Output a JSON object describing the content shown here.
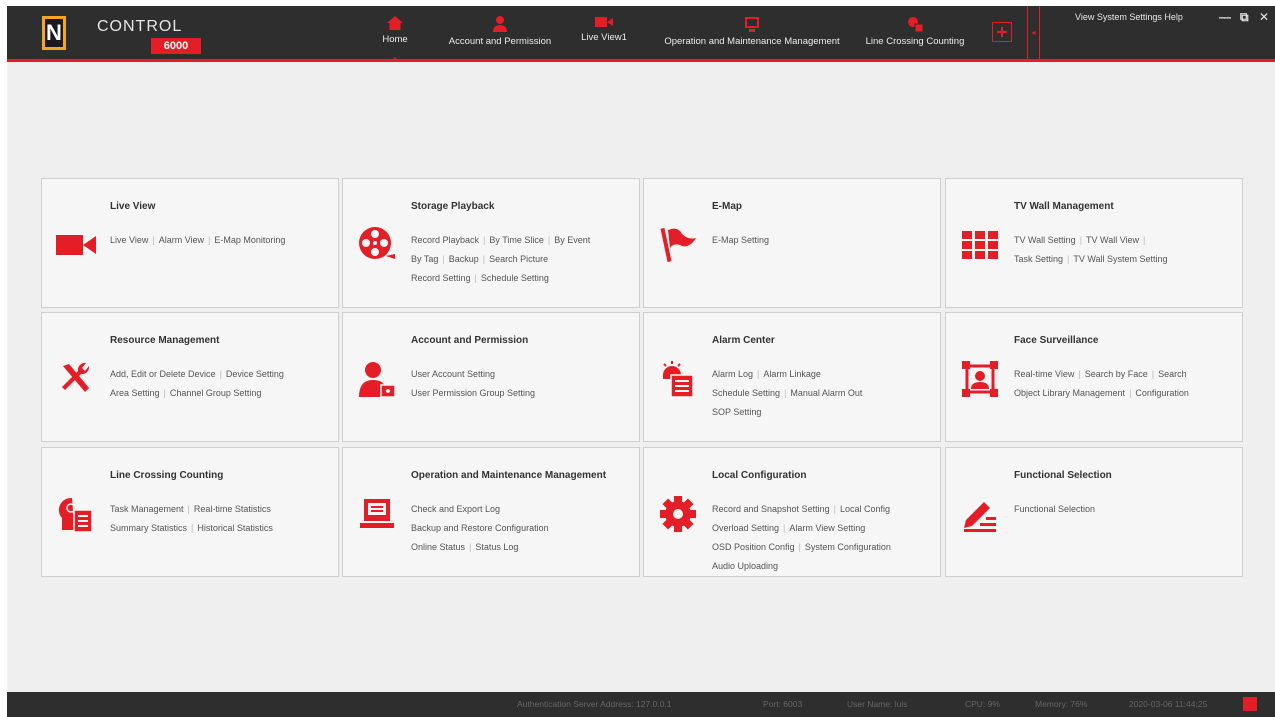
{
  "app": {
    "logo_letter": "N",
    "logo_text": "CONTROL",
    "logo_badge": "6000"
  },
  "nav": [
    {
      "label": "Home",
      "icon": "home-icon"
    },
    {
      "label": "Account and Permission",
      "icon": "user-icon"
    },
    {
      "label": "Live View1",
      "icon": "camera-icon"
    },
    {
      "label": "Operation and Maintenance Management",
      "icon": "monitor-icon"
    },
    {
      "label": "Line Crossing Counting",
      "icon": "counting-icon"
    }
  ],
  "top_menu": "View  System  Settings  Help",
  "cards": [
    {
      "title": "Live View",
      "icon": "video-camera-icon",
      "links": [
        "Live View",
        "Alarm View",
        "E-Map Monitoring"
      ]
    },
    {
      "title": "Storage Playback",
      "icon": "film-reel-icon",
      "links": [
        "Record Playback",
        "By Time Slice",
        "By Event",
        "By Tag",
        "Backup",
        "Search Picture",
        "Record Setting",
        "Schedule Setting"
      ]
    },
    {
      "title": "E-Map",
      "icon": "flag-icon",
      "links": [
        "E-Map Setting"
      ]
    },
    {
      "title": "TV Wall Management",
      "icon": "tv-wall-icon",
      "links": [
        "TV Wall Setting",
        "TV Wall View",
        "Task Setting",
        "TV Wall System Setting"
      ]
    },
    {
      "title": "Resource Management",
      "icon": "tools-icon",
      "links": [
        "Add, Edit or Delete Device",
        "Device Setting",
        "Area Setting",
        "Channel Group Setting"
      ]
    },
    {
      "title": "Account and Permission",
      "icon": "user-lock-icon",
      "links": [
        "User Account Setting",
        "User Permission Group Setting"
      ]
    },
    {
      "title": "Alarm Center",
      "icon": "alarm-list-icon",
      "links": [
        "Alarm Log",
        "Alarm Linkage",
        "Schedule Setting",
        "Manual Alarm Out",
        "SOP Setting"
      ]
    },
    {
      "title": "Face Surveillance",
      "icon": "face-scan-icon",
      "links": [
        "Real-time View",
        "Search by Face",
        "Search",
        "Object Library Management",
        "Configuration"
      ]
    },
    {
      "title": "Line Crossing Counting",
      "icon": "head-report-icon",
      "links": [
        "Task Management",
        "Real-time Statistics",
        "Summary Statistics",
        "Historical Statistics"
      ]
    },
    {
      "title": "Operation and Maintenance Management",
      "icon": "laptop-icon",
      "links": [
        "Check and Export Log",
        "Backup and Restore Configuration",
        "Online Status",
        "Status Log"
      ]
    },
    {
      "title": "Local Configuration",
      "icon": "gear-icon",
      "links": [
        "Record and Snapshot Setting",
        "Local Config",
        "Overload Setting",
        "Alarm View Setting",
        "OSD Position Config",
        "System Configuration",
        "Audio Uploading"
      ]
    },
    {
      "title": "Functional Selection",
      "icon": "edit-list-icon",
      "links": [
        "Functional Selection"
      ]
    }
  ],
  "status": {
    "auth_server": "Authentication Server Address: 127.0.0.1",
    "port": "Port: 6003",
    "user": "User Name: luis",
    "cpu": "CPU: 9%",
    "memory": "Memory: 76%",
    "datetime": "2020-03-06 11:44:25"
  },
  "colors": {
    "accent": "#e41e26",
    "titlebar": "#2e2e2e",
    "background": "#efefef"
  }
}
